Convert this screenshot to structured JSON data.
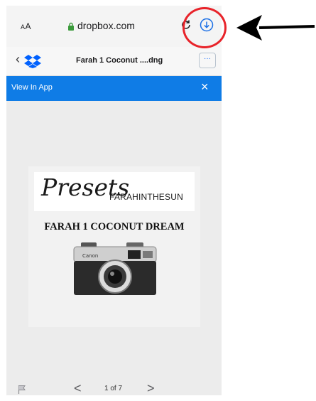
{
  "browser": {
    "text_size_label_small": "A",
    "text_size_label_large": "A",
    "url": "dropbox.com"
  },
  "header": {
    "back_glyph": "‹",
    "file_name": "Farah 1 Coconut ....dng",
    "more_glyph": "···"
  },
  "banner": {
    "text": "View In App",
    "close_glyph": "×",
    "color": "#0f7ce6"
  },
  "document": {
    "presets_script": "Presets",
    "presets_brand": "FARAHINTHESUN",
    "title": "FARAH 1 COCONUT DREAM",
    "camera_brand": "Canon"
  },
  "pager": {
    "prev_glyph": "<",
    "page_label": "1 of 7",
    "next_glyph": ">"
  },
  "annotation": {
    "highlight_color": "#e8232a",
    "arrow_color": "#000000"
  },
  "icons": [
    "lock-icon",
    "reload-icon",
    "download-icon",
    "dropbox-logo-icon",
    "flag-icon",
    "arrow-annotation"
  ]
}
